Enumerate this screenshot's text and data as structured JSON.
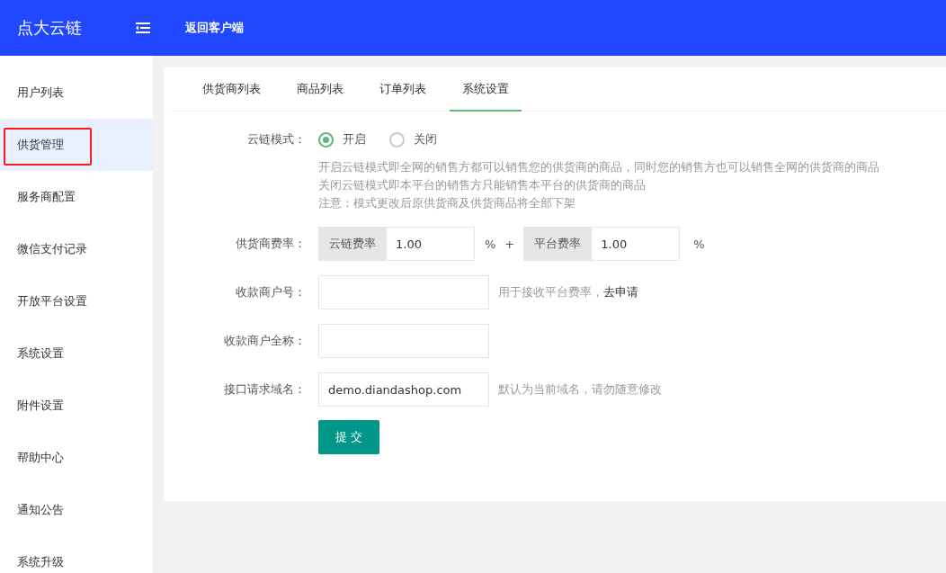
{
  "header": {
    "logo": "点大云链",
    "back_link": "返回客户端"
  },
  "sidebar": {
    "items": [
      {
        "label": "用户列表",
        "selected": false,
        "outlined": false
      },
      {
        "label": "供货管理",
        "selected": true,
        "outlined": true
      },
      {
        "label": "服务商配置",
        "selected": false,
        "outlined": false
      },
      {
        "label": "微信支付记录",
        "selected": false,
        "outlined": false
      },
      {
        "label": "开放平台设置",
        "selected": false,
        "outlined": false
      },
      {
        "label": "系统设置",
        "selected": false,
        "outlined": false
      },
      {
        "label": "附件设置",
        "selected": false,
        "outlined": false
      },
      {
        "label": "帮助中心",
        "selected": false,
        "outlined": false
      },
      {
        "label": "通知公告",
        "selected": false,
        "outlined": false
      },
      {
        "label": "系统升级",
        "selected": false,
        "outlined": false
      }
    ]
  },
  "tabs": [
    {
      "label": "供货商列表",
      "selected": false
    },
    {
      "label": "商品列表",
      "selected": false
    },
    {
      "label": "订单列表",
      "selected": false
    },
    {
      "label": "系统设置",
      "selected": true
    }
  ],
  "form": {
    "mode": {
      "label": "云链模式：",
      "options": [
        {
          "label": "开启",
          "selected": true
        },
        {
          "label": "关闭",
          "selected": false
        }
      ],
      "notes": [
        "开启云链模式即全网的销售方都可以销售您的供货商的商品，同时您的销售方也可以销售全网的供货商的商品",
        "关闭云链模式即本平台的销售方只能销售本平台的供货商的商品",
        "注意：模式更改后原供货商及供货商品将全部下架"
      ]
    },
    "fee": {
      "label": "供货商费率：",
      "operator": "+",
      "parts": [
        {
          "addon": "云链费率",
          "value": "1.00",
          "unit": "%"
        },
        {
          "addon": "平台费率",
          "value": "1.00",
          "unit": "%"
        }
      ]
    },
    "fields": [
      {
        "label": "收款商户号：",
        "hint": "用于接收平台费率，",
        "link": "去申请"
      },
      {
        "label": "收款商户全称："
      },
      {
        "label": "接口请求域名：",
        "value": "demo.diandashop.com",
        "hint": "默认为当前域名，请勿随意修改"
      }
    ],
    "submit": "提 交"
  }
}
